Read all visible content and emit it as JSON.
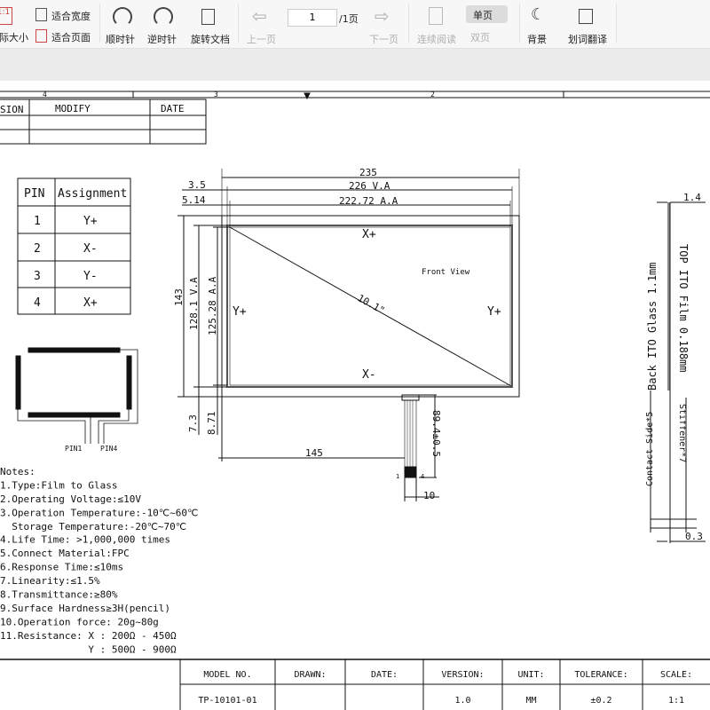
{
  "toolbar": {
    "actual_size": "实际大小",
    "actual_size_icon": "1:1",
    "fit_width": "适合宽度",
    "fit_page": "适合页面",
    "clockwise": "顺时针",
    "counterclockwise": "逆时针",
    "rotate_doc": "旋转文档",
    "prev_page": "上一页",
    "page_value": "1",
    "page_total": "/1页",
    "next_page": "下一页",
    "continuous": "连续阅读",
    "single": "单页",
    "double": "双页",
    "background": "背景",
    "translate": "划词翻译"
  },
  "drawing": {
    "zones": [
      "4",
      "3",
      "2"
    ],
    "revision_table": {
      "headers": [
        "SION",
        "MODIFY",
        "DATE"
      ]
    },
    "pin_table": {
      "headers": [
        "PIN",
        "Assignment"
      ],
      "rows": [
        [
          "1",
          "Y+"
        ],
        [
          "2",
          "X-"
        ],
        [
          "3",
          "Y-"
        ],
        [
          "4",
          "X+"
        ]
      ]
    },
    "pin_labels": [
      "PIN1",
      "PIN4"
    ],
    "dims": {
      "w235": "235",
      "w226": "226 V.A",
      "w222": "222.72 A.A",
      "d35": "3.5",
      "d514": "5.14",
      "h143": "143",
      "h128": "128.1 V.A",
      "h125": "125.28 A.A",
      "d73": "7.3",
      "d871": "8.71",
      "d145": "145",
      "fpc": "89.4±0.5",
      "fpc_w": "10",
      "pin1": "1",
      "pin4": "4"
    },
    "panel": {
      "xp": "X+",
      "xm": "X-",
      "yl": "Y+",
      "yr": "Y+",
      "diag": "10.1\"",
      "view": "Front View"
    },
    "side": {
      "d14": "1.4",
      "d03": "0.3",
      "glass": "Back ITO Glass 1.1mm",
      "film": "TOP ITO Film 0.188mm",
      "contact": "Contact Side*5",
      "stiff": "Stiffener*7"
    },
    "notes": [
      "Notes:",
      "1.Type:Film to Glass",
      "2.Operating Voltage:≤10V",
      "3.Operation Temperature:-10℃~60℃",
      "  Storage Temperature:-20℃~70℃",
      "4.Life Time: >1,000,000 times",
      "5.Connect Material:FPC",
      "6.Response Time:≤10ms",
      "7.Linearity:≤1.5%",
      "8.Transmittance:≥80%",
      "9.Surface Hardness≥3H(pencil)",
      "10.Operation force: 20g~80g",
      "11.Resistance: X : 200Ω - 450Ω",
      "               Y : 500Ω - 900Ω"
    ],
    "title_block": {
      "headers": [
        "MODEL NO.",
        "DRAWN:",
        "DATE:",
        "VERSION:",
        "UNIT:",
        "TOLERANCE:",
        "SCALE:"
      ],
      "values": [
        "TP-10101-01",
        "",
        "",
        "1.0",
        "MM",
        "±0.2",
        "1:1"
      ]
    }
  }
}
